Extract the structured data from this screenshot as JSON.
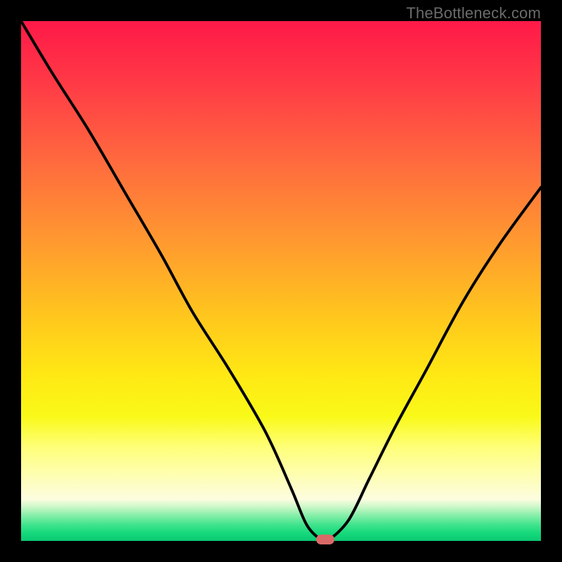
{
  "attribution": "TheBottleneck.com",
  "colors": {
    "page_bg": "#000000",
    "curve_stroke": "#000000",
    "marker_fill": "#d96a67",
    "attribution_text": "#6b6b6b"
  },
  "chart_data": {
    "type": "line",
    "title": "",
    "xlabel": "",
    "ylabel": "",
    "xlim": [
      0,
      100
    ],
    "ylim": [
      0,
      100
    ],
    "grid": false,
    "series": [
      {
        "name": "bottleneck-curve",
        "x": [
          0,
          6,
          13,
          20,
          27,
          33,
          40,
          47,
          52,
          55,
          58,
          59,
          63,
          67,
          72,
          78,
          85,
          92,
          100
        ],
        "values": [
          100,
          90,
          79,
          67,
          55,
          44,
          33,
          21,
          10,
          3,
          0,
          0,
          4,
          12,
          22,
          33,
          46,
          57,
          68
        ]
      }
    ],
    "marker": {
      "x": 58.5,
      "y": 0
    },
    "background_gradient": [
      {
        "stop": 0,
        "color": "#ff1948"
      },
      {
        "stop": 0.12,
        "color": "#ff3a46"
      },
      {
        "stop": 0.27,
        "color": "#ff6a3e"
      },
      {
        "stop": 0.42,
        "color": "#ff9830"
      },
      {
        "stop": 0.56,
        "color": "#ffc41e"
      },
      {
        "stop": 0.68,
        "color": "#ffe814"
      },
      {
        "stop": 0.76,
        "color": "#f9f918"
      },
      {
        "stop": 0.82,
        "color": "#ffff7a"
      },
      {
        "stop": 0.895,
        "color": "#fdfdc8"
      },
      {
        "stop": 0.92,
        "color": "#fdfde0"
      },
      {
        "stop": 0.935,
        "color": "#c9f7c7"
      },
      {
        "stop": 0.95,
        "color": "#8aefaa"
      },
      {
        "stop": 0.97,
        "color": "#3de38c"
      },
      {
        "stop": 0.985,
        "color": "#16d97c"
      },
      {
        "stop": 1.0,
        "color": "#0bc972"
      }
    ]
  }
}
